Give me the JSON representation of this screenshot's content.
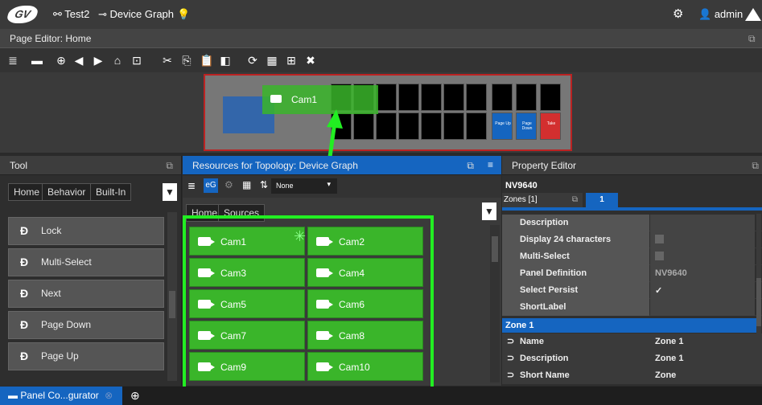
{
  "topbar": {
    "logo": "GV",
    "network_label": "Test2",
    "graph_label": "Device Graph",
    "user": "admin"
  },
  "editor": {
    "title": "Page Editor: Home"
  },
  "canvas": {
    "drag_label": "Cam1",
    "key_labels": {
      "page_up": "Page Up",
      "page_down": "Page Down",
      "take": "Take"
    }
  },
  "tool": {
    "title": "Tool",
    "breadcrumbs": [
      "Home",
      "Behavior",
      "Built-In"
    ],
    "items": [
      "Lock",
      "Multi-Select",
      "Next",
      "Page Down",
      "Page Up"
    ]
  },
  "resources": {
    "title": "Resources for Topology: Device Graph",
    "filter_value": "None",
    "breadcrumbs": [
      "Home",
      "Sources"
    ],
    "sources": [
      "Cam1",
      "Cam2",
      "Cam3",
      "Cam4",
      "Cam5",
      "Cam6",
      "Cam7",
      "Cam8",
      "Cam9",
      "Cam10"
    ]
  },
  "props": {
    "title": "Property Editor",
    "device": "NV9640",
    "zones_label": "Zones [1]",
    "zone_tab": "1",
    "rows": [
      {
        "key": "Description",
        "value": ""
      },
      {
        "key": "Display 24 characters",
        "value": ""
      },
      {
        "key": "Multi-Select",
        "value": ""
      },
      {
        "key": "Panel Definition",
        "value": "NV9640"
      },
      {
        "key": "Select Persist",
        "value": "✓"
      },
      {
        "key": "ShortLabel",
        "value": ""
      }
    ],
    "zone_section": "Zone 1",
    "zone_rows": [
      {
        "key": "Name",
        "value": "Zone 1"
      },
      {
        "key": "Description",
        "value": "Zone 1"
      },
      {
        "key": "Short Name",
        "value": "Zone"
      }
    ]
  },
  "taskbar": {
    "tab_label": "Panel Co...gurator"
  },
  "colors": {
    "accent": "#1565c0",
    "source_green": "#3ab52a",
    "highlight": "#22ee22"
  }
}
